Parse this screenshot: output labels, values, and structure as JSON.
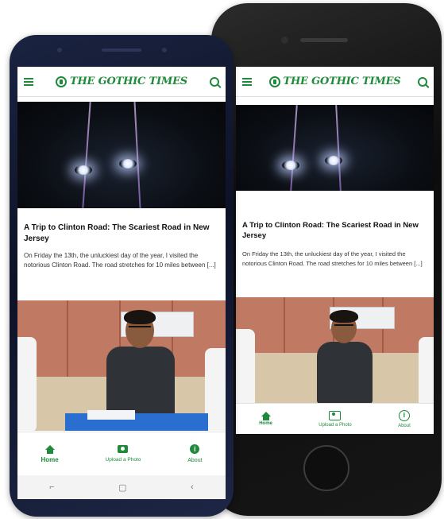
{
  "app": {
    "brand_name": "THE GOTHIC TIMES",
    "accent_color": "#1f8a3a",
    "menu_icon": "hamburger-icon",
    "search_icon": "search-icon"
  },
  "article": {
    "title": "A Trip to Clinton Road:  The Scariest Road in New Jersey",
    "excerpt_front": "On Friday the 13th, the unluckiest day of the year, I visited the notorious Clinton Road. The road stretches for 10 miles between [...]",
    "excerpt_back": "On Friday the 13th, the unluckiest day of the year, I visited the notorious Clinton Road. The road stretches for 10 miles between [...]"
  },
  "bottom_nav": {
    "items": [
      {
        "label": "Home",
        "icon": "home-icon"
      },
      {
        "label": "Upload a Photo",
        "icon": "camera-icon"
      },
      {
        "label": "About",
        "icon": "info-icon"
      }
    ]
  },
  "android_nav": {
    "back_glyph": "‹",
    "home_glyph": "▢",
    "recent_glyph": "⌐"
  }
}
